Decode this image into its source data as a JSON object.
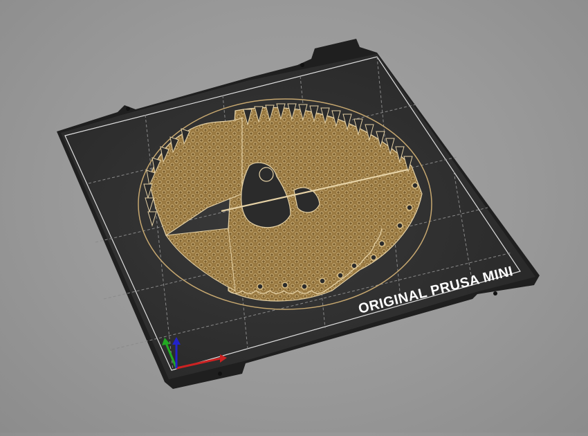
{
  "viewport": {
    "bed_label": "ORIGINAL PRUSA MINI",
    "background_color": "#999999",
    "bed_color": "#2b2b2b",
    "model_color": "#b08a4a",
    "axes": {
      "x_color": "#cc2222",
      "y_color": "#22aa22",
      "z_color": "#2222cc"
    }
  }
}
